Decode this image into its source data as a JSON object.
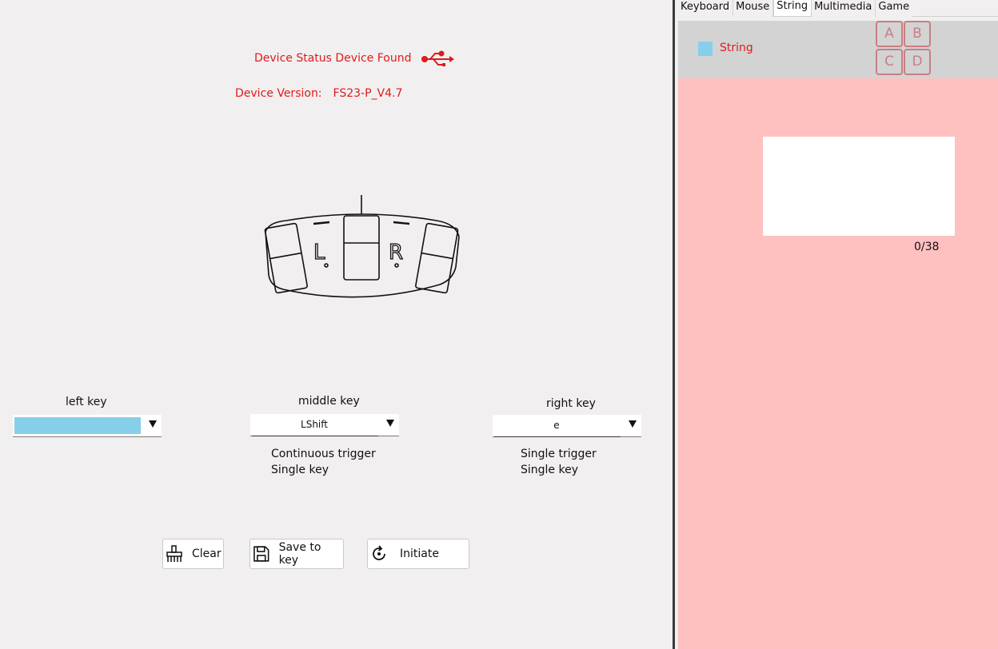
{
  "device": {
    "status_label": "Device Status",
    "status_value": "Device Found",
    "version_label": "Device Version:",
    "version_value": "FS23-P_V4.7",
    "status_color": "#e01a1a",
    "usb_icon": "usb-icon"
  },
  "pedal_image": {
    "left_letter": "L",
    "right_letter": "R"
  },
  "keys": {
    "left": {
      "label": "left key",
      "value": "",
      "info": []
    },
    "middle": {
      "label": "middle key",
      "value": "LShift",
      "info": [
        "Continuous trigger",
        "Single key"
      ]
    },
    "right": {
      "label": "right key",
      "value": "e",
      "info": [
        "Single trigger",
        "Single key"
      ]
    },
    "selection_color": "#87ceeb"
  },
  "buttons": {
    "clear": "Clear",
    "save": "Save to key",
    "initiate": "Initiate"
  },
  "tabs": [
    "Keyboard",
    "Mouse",
    "String",
    "Multimedia",
    "Game"
  ],
  "active_tab": "String",
  "string_panel": {
    "mode_label": "String",
    "letters": [
      "A",
      "B",
      "C",
      "D"
    ],
    "input_value": "",
    "counter": "0/38",
    "bg_color": "#ffc0c0"
  }
}
